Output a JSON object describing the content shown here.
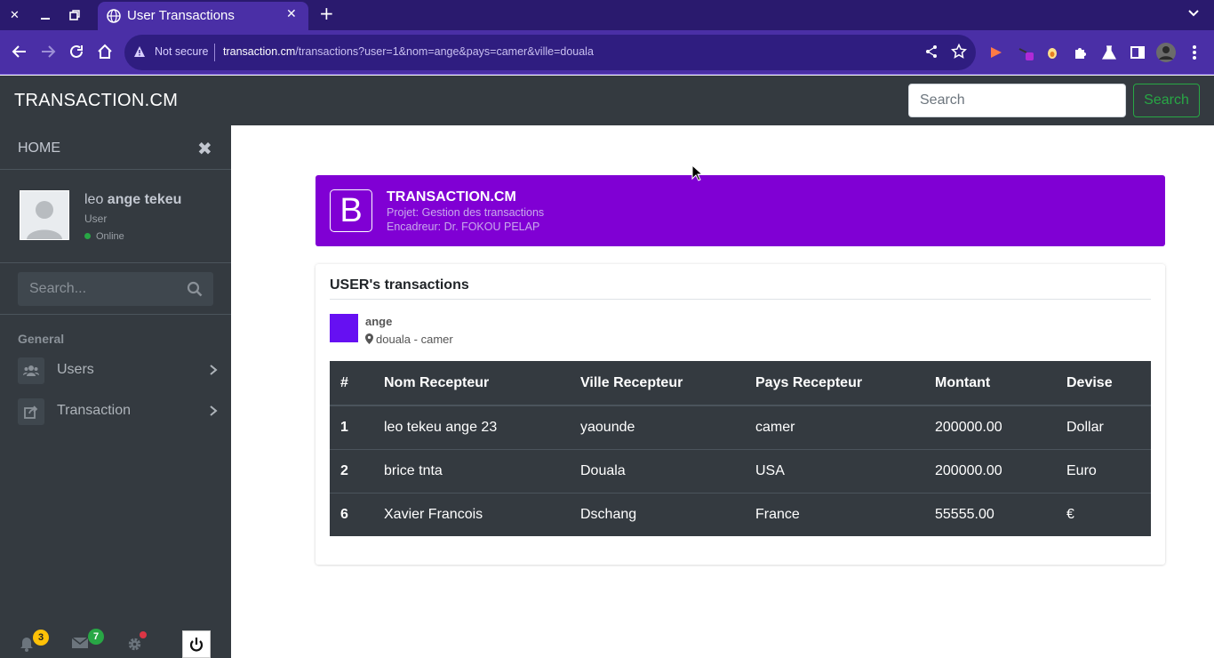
{
  "browser": {
    "tab_title": "User Transactions",
    "security_label": "Not secure",
    "url_host": "transaction.cm",
    "url_path": "/transactions?user=1&nom=ange&pays=camer&ville=douala"
  },
  "header": {
    "brand": "TRANSACTION.CM",
    "search_placeholder": "Search",
    "search_button": "Search"
  },
  "sidebar": {
    "home_label": "HOME",
    "user": {
      "first": "leo ",
      "bold": "ange tekeu",
      "role": "User",
      "status": "Online"
    },
    "search_placeholder": "Search...",
    "section_label": "General",
    "items": [
      {
        "label": "Users",
        "icon": "users-icon"
      },
      {
        "label": "Transaction",
        "icon": "share-square-icon"
      }
    ],
    "footer": {
      "notifications_count": "3",
      "messages_count": "7"
    }
  },
  "brand_card": {
    "logo_letter": "B",
    "title": "TRANSACTION.CM",
    "line1": "Projet: Gestion des transactions",
    "line2": "Encadreur: Dr. FOKOU PELAP"
  },
  "panel": {
    "title": "USER's transactions",
    "user_name": "ange",
    "user_location": "douala - camer",
    "table": {
      "headers": [
        "#",
        "Nom Recepteur",
        "Ville Recepteur",
        "Pays Recepteur",
        "Montant",
        "Devise"
      ],
      "rows": [
        [
          "1",
          "leo tekeu ange 23",
          "yaounde",
          "camer",
          "200000.00",
          "Dollar"
        ],
        [
          "2",
          "brice tnta",
          "Douala",
          "USA",
          "200000.00",
          "Euro"
        ],
        [
          "6",
          "Xavier Francois",
          "Dschang",
          "France",
          "55555.00",
          "€"
        ]
      ]
    }
  },
  "colors": {
    "brand_card_bg": "#8000d4",
    "user_square": "#6610f2",
    "sidebar_bg": "#343a40",
    "browser_toolbar": "#4a2fa6",
    "search_accent": "#28a745"
  }
}
